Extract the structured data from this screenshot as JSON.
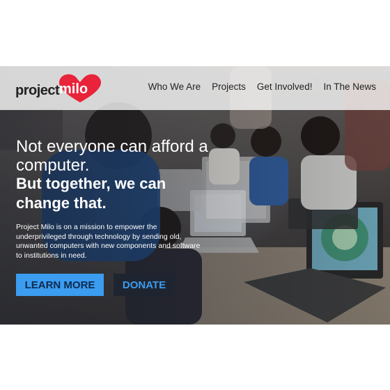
{
  "brand": {
    "name_part1": "project",
    "name_part2": "milo",
    "accent_color": "#e8233a"
  },
  "nav": {
    "items": [
      {
        "label": "Who We Are"
      },
      {
        "label": "Projects"
      },
      {
        "label": "Get Involved!"
      },
      {
        "label": "In The News"
      }
    ]
  },
  "hero": {
    "headline": "Not everyone can afford a computer.",
    "subheadline": "But together, we can change that.",
    "description": "Project Milo is on a mission to empower the underprivileged through technology by sending old, unwanted computers with new components and software to institutions in need.",
    "primary_button": "LEARN MORE",
    "secondary_button": "DONATE",
    "primary_button_color": "#3b9cf0",
    "secondary_button_color": "#1f2530"
  }
}
